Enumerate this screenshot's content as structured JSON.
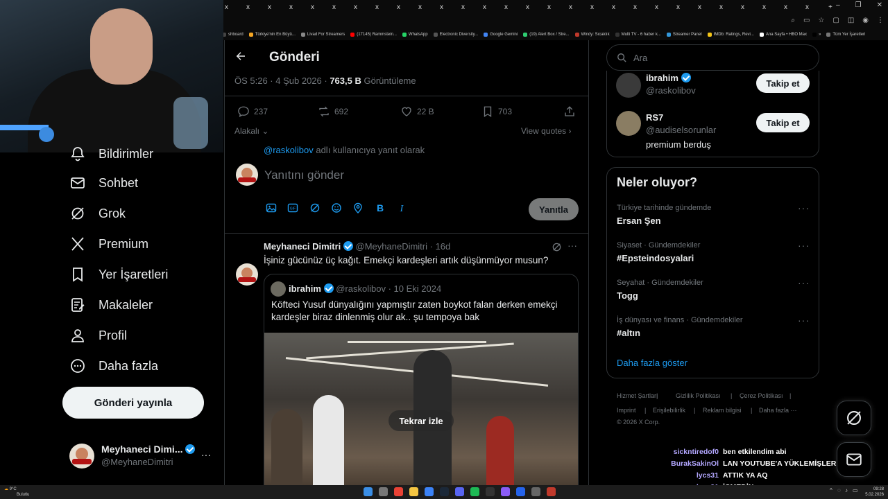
{
  "browser": {
    "tab_label": "x",
    "tab_count": 28,
    "bookmarks": [
      {
        "label": "shboard",
        "color": "#444"
      },
      {
        "label": "Türkiye'nin En Büyü...",
        "color": "#f5a623"
      },
      {
        "label": "Livad For Streamers",
        "color": "#888"
      },
      {
        "label": "(17145) Rammstein...",
        "color": "#ff0000"
      },
      {
        "label": "WhatsApp",
        "color": "#25d366"
      },
      {
        "label": "Electronic Diversity...",
        "color": "#555"
      },
      {
        "label": "Google Gemini",
        "color": "#4285f4"
      },
      {
        "label": "(19) Alert Box / Stre...",
        "color": "#2ecc71"
      },
      {
        "label": "Windy: Sıcaklık",
        "color": "#c0392b"
      },
      {
        "label": "Multi TV - 6 haber k...",
        "color": "#333"
      },
      {
        "label": "Streamer Panel",
        "color": "#3498db"
      },
      {
        "label": "IMDb: Ratings, Revi...",
        "color": "#f5c518"
      },
      {
        "label": "Ana Sayfa • HBO Max",
        "color": "#fff"
      },
      {
        "label": "»",
        "color": "#000"
      },
      {
        "label": "Tüm Yer İşaretleri",
        "color": "#777"
      }
    ]
  },
  "nav": {
    "items": [
      {
        "label": "Bildirimler",
        "icon": "bell-icon"
      },
      {
        "label": "Sohbet",
        "icon": "mail-icon"
      },
      {
        "label": "Grok",
        "icon": "grok-icon"
      },
      {
        "label": "Premium",
        "icon": "x-logo-icon"
      },
      {
        "label": "Yer İşaretleri",
        "icon": "bookmark-icon"
      },
      {
        "label": "Makaleler",
        "icon": "article-icon"
      },
      {
        "label": "Profil",
        "icon": "person-icon"
      },
      {
        "label": "Daha fazla",
        "icon": "more-circle-icon"
      }
    ],
    "post_button": "Gönderi yayınla",
    "account": {
      "name": "Meyhaneci Dimi...",
      "handle": "@MeyhaneDimitri",
      "more": "···"
    }
  },
  "header": {
    "title": "Gönderi"
  },
  "post": {
    "time": "ÖS 5:26 · 4 Şub 2026 · ",
    "views_value": "763,5 B",
    "views_label": " Görüntüleme",
    "stats": {
      "replies": "237",
      "reposts": "692",
      "likes": "22 B",
      "bookmarks": "703"
    },
    "relevance": "Alakalı",
    "view_quotes": "View quotes"
  },
  "reply_box": {
    "replying_handle": "@raskolibov",
    "replying_suffix": " adlı kullanıcıya yanıt olarak",
    "placeholder": "Yanıtını gönder",
    "submit": "Yanıtla"
  },
  "reply_tweet": {
    "name": "Meyhaneci Dimitri",
    "handle": "@MeyhaneDimitri",
    "age": "· 16d",
    "text": "İşiniz gücünüz üç kağıt. Emekçi kardeşleri artık düşünmüyor musun?",
    "quote": {
      "name": "ibrahim",
      "handle": "@raskolibov",
      "date": "· 10 Eki 2024",
      "text": "Köfteci Yusuf dünyalığını yapmıştır zaten boykot falan derken emekçi kardeşler biraz dinlenmiş olur ak.. şu tempoya bak",
      "replay": "Tekrar izle"
    }
  },
  "search": {
    "placeholder": "Ara"
  },
  "who_to_follow": [
    {
      "name": "ibrahim",
      "handle": "@raskolibov",
      "bio": "",
      "button": "Takip et"
    },
    {
      "name": "RS7",
      "handle": "@audiselsorunlar",
      "bio": "premium berduş",
      "button": "Takip et"
    }
  ],
  "trends": {
    "title": "Neler oluyor?",
    "items": [
      {
        "meta": "Türkiye tarihinde gündemde",
        "name": "Ersan Şen"
      },
      {
        "meta": "Siyaset · Gündemdekiler",
        "name": "#Epsteindosyalari"
      },
      {
        "meta": "Seyahat · Gündemdekiler",
        "name": "Togg"
      },
      {
        "meta": "İş dünyası ve finans · Gündemdekiler",
        "name": "#altın"
      }
    ],
    "show_more": "Daha fazla göster"
  },
  "footer": {
    "links": [
      "Hizmet Şartları",
      "|",
      "Gizlilik Politikası",
      "|",
      "Çerez Politikası",
      "|",
      "Imprint",
      "|",
      "Erişilebilirlik",
      "|",
      "Reklam bilgisi",
      "|",
      "Daha fazla ···"
    ],
    "copyright": "© 2026 X Corp."
  },
  "chat": [
    {
      "user": "sickntiredof0",
      "msg": "ben etkilendim abi"
    },
    {
      "user": "BurakSakinOl",
      "msg": "LAN YOUTUBE'A YÜKLEMİŞLER"
    },
    {
      "user": "lycs31",
      "msg": "ATTIK YA AQ"
    },
    {
      "user": "lycs31",
      "msg": "İÇMEDİN"
    }
  ],
  "taskbar": {
    "weather_temp": "9°C",
    "weather_text": "Bulutlu",
    "time": "09:28",
    "date": "5.02.2026"
  },
  "colors": {
    "accent": "#1d9bf0",
    "border": "#2f3336",
    "muted": "#71767b"
  }
}
